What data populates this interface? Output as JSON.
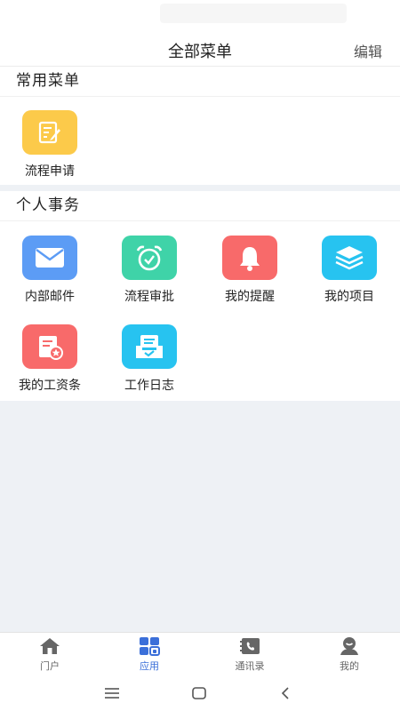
{
  "header": {
    "title": "全部菜单",
    "edit_label": "编辑"
  },
  "sections": {
    "common": {
      "title": "常用菜单",
      "items": [
        {
          "label": "流程申请",
          "icon": "form-edit-icon",
          "color": "#fcca4a"
        }
      ]
    },
    "personal": {
      "title": "个人事务",
      "items": [
        {
          "label": "内部邮件",
          "icon": "mail-icon",
          "color": "#5c9cf5"
        },
        {
          "label": "流程审批",
          "icon": "alarm-clock-icon",
          "color": "#3fd3a8"
        },
        {
          "label": "我的提醒",
          "icon": "bell-icon",
          "color": "#f86a6a"
        },
        {
          "label": "我的项目",
          "icon": "layers-icon",
          "color": "#27c3f0"
        },
        {
          "label": "我的工资条",
          "icon": "payslip-icon",
          "color": "#f86a6a"
        },
        {
          "label": "工作日志",
          "icon": "work-log-icon",
          "color": "#27c3f0"
        }
      ]
    }
  },
  "tabbar": {
    "active": "应用",
    "tabs": [
      {
        "label": "门户",
        "icon": "home-icon"
      },
      {
        "label": "应用",
        "icon": "apps-grid-icon"
      },
      {
        "label": "通讯录",
        "icon": "contacts-phone-icon"
      },
      {
        "label": "我的",
        "icon": "user-profile-icon"
      }
    ],
    "accent_color": "#3b6fd9"
  }
}
